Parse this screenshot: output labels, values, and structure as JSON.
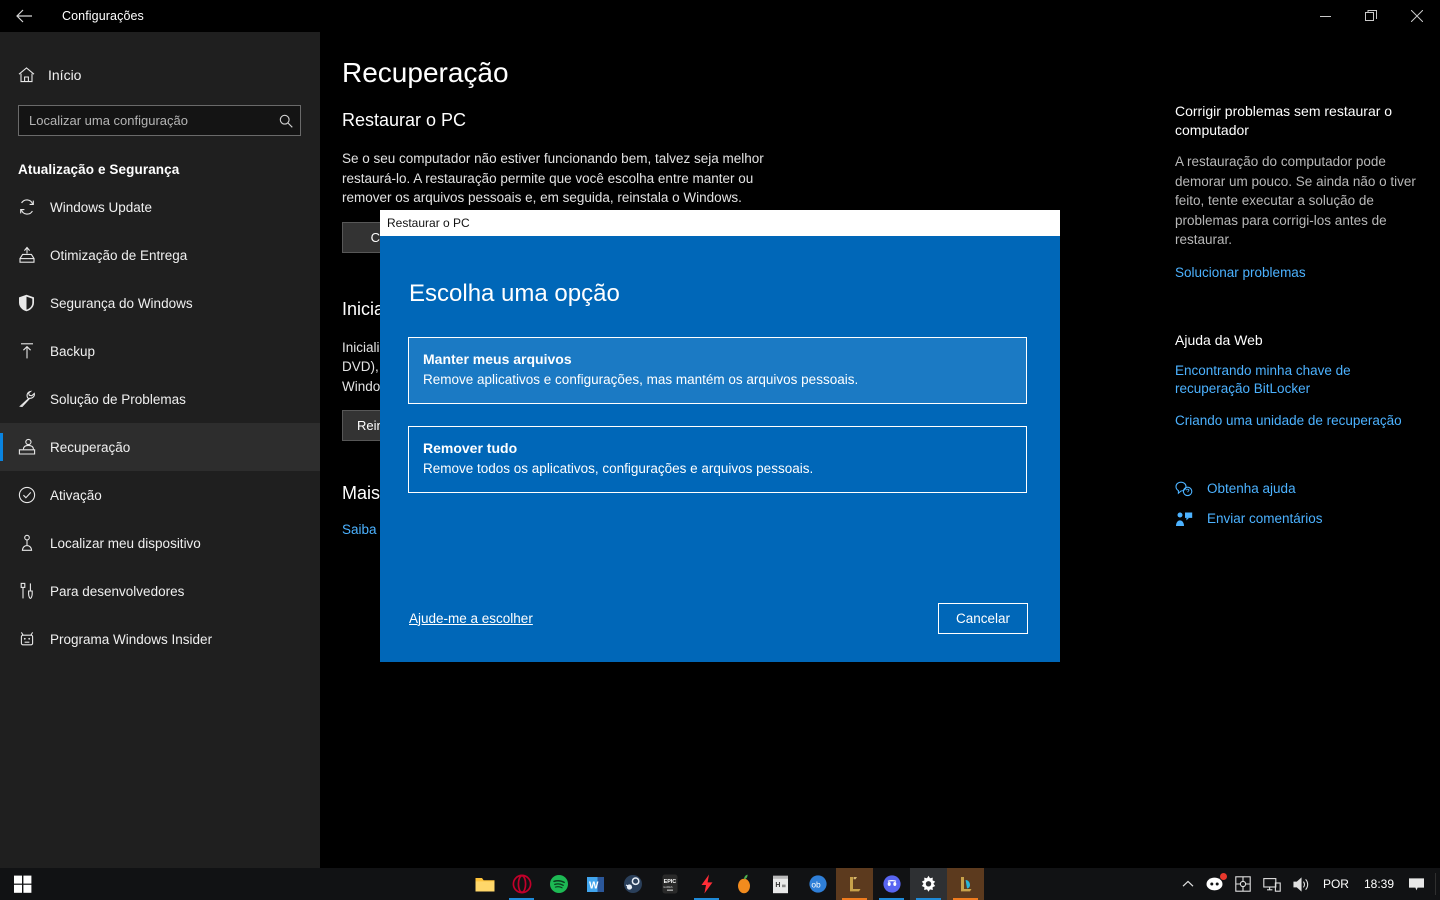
{
  "window": {
    "title": "Configurações",
    "back_icon": "back-arrow-icon",
    "minimize_label": "Minimizar",
    "maximize_label": "Restaurar",
    "close_label": "Fechar"
  },
  "sidebar": {
    "home": {
      "label": "Início",
      "icon": "home-icon"
    },
    "search": {
      "placeholder": "Localizar uma configuração",
      "value": "",
      "icon": "search-icon"
    },
    "section_title": "Atualização e Segurança",
    "items": [
      {
        "label": "Windows Update",
        "icon": "refresh-icon",
        "active": false
      },
      {
        "label": "Otimização de Entrega",
        "icon": "delivery-icon",
        "active": false
      },
      {
        "label": "Segurança do Windows",
        "icon": "shield-icon",
        "active": false
      },
      {
        "label": "Backup",
        "icon": "upload-arrow-icon",
        "active": false
      },
      {
        "label": "Solução de Problemas",
        "icon": "wrench-icon",
        "active": false
      },
      {
        "label": "Recuperação",
        "icon": "recovery-icon",
        "active": true
      },
      {
        "label": "Ativação",
        "icon": "check-circle-icon",
        "active": false
      },
      {
        "label": "Localizar meu dispositivo",
        "icon": "locate-device-icon",
        "active": false
      },
      {
        "label": "Para desenvolvedores",
        "icon": "dev-tools-icon",
        "active": false
      },
      {
        "label": "Programa Windows Insider",
        "icon": "insider-bug-icon",
        "active": false
      }
    ]
  },
  "main": {
    "page_title": "Recuperação",
    "sections": [
      {
        "heading": "Restaurar o PC",
        "body": "Se o seu computador não estiver funcionando bem, talvez seja melhor restaurá-lo. A restauração permite que você escolha entre manter ou remover os arquivos pessoais e, em seguida, reinstala o Windows.",
        "button": "Começar"
      },
      {
        "heading": "Inicialização avançada",
        "body": "Inicialize a partir de um dispositivo ou disco (como uma unidade USB ou DVD), altere as configurações de inicialização do Windows ou restaure o Windows a partir de uma imagem do sistema.",
        "button": "Reiniciar agora"
      },
      {
        "heading": "Mais opções de recuperação",
        "link": "Saiba como começar do zero com uma instalação limpa do Windows"
      }
    ]
  },
  "help_pane": {
    "title": "Corrigir problemas sem restaurar o computador",
    "text": "A restauração do computador pode demorar um pouco. Se ainda não o tiver feito, tente executar a solução de problemas para corrigi-los antes de restaurar.",
    "primary_link": "Solucionar problemas",
    "web_help_heading": "Ajuda da Web",
    "web_links": [
      "Encontrando minha chave de recuperação BitLocker",
      "Criando uma unidade de recuperação"
    ],
    "action_links": [
      {
        "label": "Obtenha ajuda",
        "icon": "question-bubble-icon"
      },
      {
        "label": "Enviar comentários",
        "icon": "feedback-icon"
      }
    ]
  },
  "dialog": {
    "titlebar": "Restaurar o PC",
    "heading": "Escolha uma opção",
    "options": [
      {
        "title": "Manter meus arquivos",
        "description": "Remove aplicativos e configurações, mas mantém os arquivos pessoais.",
        "hovered": true
      },
      {
        "title": "Remover tudo",
        "description": "Remove todos os aplicativos, configurações e arquivos pessoais.",
        "hovered": false
      }
    ],
    "help_link": "Ajude-me a escolher",
    "cancel_button": "Cancelar",
    "accent_color": "#0067b8",
    "hover_color": "#1b7ac4"
  },
  "taskbar": {
    "start_icon": "windows-start-icon",
    "apps": [
      {
        "name": "file-explorer",
        "glyph": "🗂",
        "color": "#ffc33b",
        "running": false,
        "underline": ""
      },
      {
        "name": "opera",
        "glyph": "O",
        "color": "#c2002a",
        "running": true,
        "underline": "#1f8ad8"
      },
      {
        "name": "spotify",
        "glyph": "♪",
        "color": "#1db954",
        "running": false,
        "underline": ""
      },
      {
        "name": "word",
        "glyph": "W",
        "color": "#2b579a",
        "running": false,
        "underline": ""
      },
      {
        "name": "steam",
        "glyph": "✇",
        "color": "#dfe6ef",
        "running": false,
        "underline": ""
      },
      {
        "name": "epic-games",
        "glyph": "EPIC",
        "color": "#f2f2f2",
        "running": false,
        "underline": ""
      },
      {
        "name": "flash-app",
        "glyph": "⚡",
        "color": "#ff2d37",
        "running": true,
        "underline": "#1f8ad8"
      },
      {
        "name": "fl-studio",
        "glyph": "●",
        "color": "#f28b1e",
        "running": false,
        "underline": ""
      },
      {
        "name": "notes-app",
        "glyph": "H",
        "color": "#d8d8d8",
        "running": false,
        "underline": ""
      },
      {
        "name": "ob-app",
        "glyph": "ob",
        "color": "#2f7fd8",
        "running": false,
        "underline": ""
      },
      {
        "name": "league-of-legends",
        "glyph": "L",
        "color": "#c8a24a",
        "running": true,
        "underline": "#f07b1e"
      },
      {
        "name": "discord",
        "glyph": "D",
        "color": "#5865f2",
        "running": true,
        "underline": "#1f8ad8"
      },
      {
        "name": "settings",
        "glyph": "⚙",
        "color": "#ffffff",
        "running": true,
        "underline": "#1f8ad8"
      },
      {
        "name": "league-client",
        "glyph": "L",
        "color": "#c8a24a",
        "running": true,
        "underline": "#f07b1e"
      }
    ],
    "tray": {
      "overflow_icon": "chevron-up-icon",
      "icons": [
        {
          "name": "discord-tray-icon",
          "badge": true
        },
        {
          "name": "game-controller-icon",
          "badge": false
        },
        {
          "name": "network-icon",
          "badge": false
        },
        {
          "name": "volume-icon",
          "badge": false
        }
      ],
      "language": "POR",
      "clock": "18:39",
      "notification_icon": "notification-icon"
    }
  }
}
